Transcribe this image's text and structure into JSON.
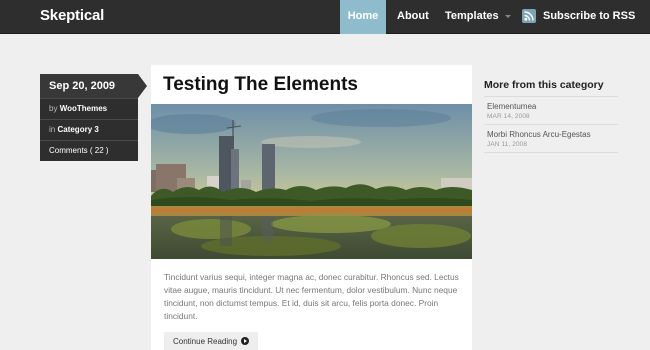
{
  "header": {
    "logo": "Skeptical",
    "nav": [
      {
        "label": "Home"
      },
      {
        "label": "About"
      },
      {
        "label": "Templates"
      }
    ],
    "rss_label": "Subscribe to RSS",
    "accent_color": "#8fbccd"
  },
  "meta": {
    "date": "Sep 20, 2009",
    "author_prefix": "by",
    "author": "WooThemes",
    "category_prefix": "in",
    "category": "Category 3",
    "comments": "Comments ( 22 )"
  },
  "post": {
    "title": "Testing The Elements",
    "excerpt": "Tincidunt varius sequi, integer magna ac, donec curabitur. Rhoncus sed. Lectus vitae augue, mauris tincidunt. Ut nec fermentum, dolor vestibulum. Nunc neque tincidunt, non dictumst tempus. Et id, duis sit arcu, felis porta donec. Proin tincidunt.",
    "continue_label": "Continue Reading"
  },
  "sidebar": {
    "title": "More from this category",
    "items": [
      {
        "title": "Elementumea",
        "date": "MAR 14, 2008"
      },
      {
        "title": "Morbi Rhoncus Arcu-Egestas",
        "date": "JAN 11, 2008"
      }
    ]
  }
}
